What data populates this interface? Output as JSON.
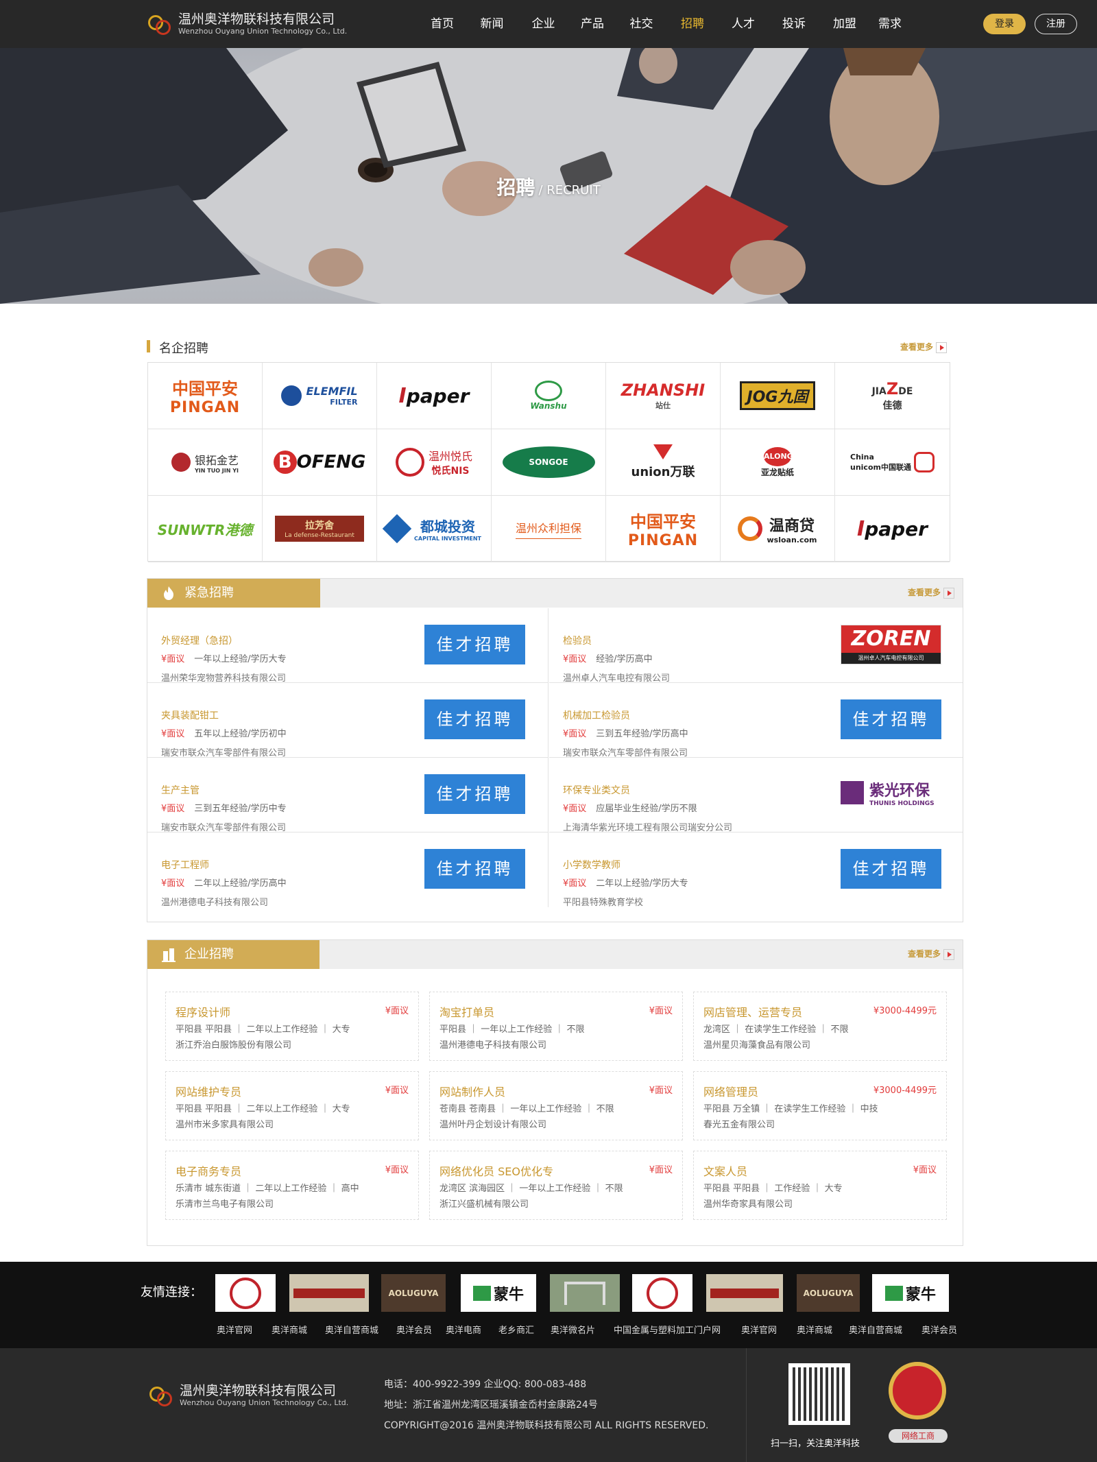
{
  "header": {
    "brand_zh": "温州奥洋物联科技有限公司",
    "brand_en": "Wenzhou Ouyang Union Technology Co., Ltd.",
    "nav": [
      "首页",
      "新闻",
      "企业",
      "产品",
      "社交",
      "招聘",
      "人才",
      "投诉",
      "加盟",
      "需求"
    ],
    "active_nav": "招聘",
    "login": "登录",
    "register": "注册"
  },
  "banner": {
    "title": "招聘",
    "subtitle": "/ RECRUIT"
  },
  "famous": {
    "title": "名企招聘",
    "more": "查看更多",
    "logos": [
      [
        "中国平安 PINGAN",
        "ELEMFIL FILTER",
        "paper",
        "Wanshu",
        "ZHANSHI 站仕",
        "JOG九固",
        "JIAZDE 佳德"
      ],
      [
        "银拓金艺",
        "BOFENG",
        "温州悦氏 悦氏NIS",
        "SONGOE",
        "union万联",
        "ALONG 亚龙贴纸",
        "China unicom中国联通"
      ],
      [
        "SUNWTR港德",
        "拉芳舍 La defense-Restaurant",
        "都城投资 CAPITAL INVESTMENT",
        "温州众利担保",
        "中国平安 PINGAN",
        "温商贷 wsloan.com",
        "paper"
      ]
    ]
  },
  "urgent": {
    "title": "紧急招聘",
    "more": "查看更多",
    "badge": "¥面议",
    "jiacai": "佳才招聘",
    "jobs": [
      {
        "title": "外贸经理（急招）",
        "req": "一年以上经验/学历大专",
        "company": "温州荣华宠物营养科技有限公司",
        "logo": "jiacai"
      },
      {
        "title": "检验员",
        "req": "经验/学历高中",
        "company": "温州卓人汽车电控有限公司",
        "logo": "ZOREN",
        "logo_sub": "温州卓人汽车电控有限公司"
      },
      {
        "title": "夹具装配钳工",
        "req": "五年以上经验/学历初中",
        "company": "瑞安市联众汽车零部件有限公司",
        "logo": "jiacai"
      },
      {
        "title": "机械加工检验员",
        "req": "三到五年经验/学历高中",
        "company": "瑞安市联众汽车零部件有限公司",
        "logo": "jiacai"
      },
      {
        "title": "生产主管",
        "req": "三到五年经验/学历中专",
        "company": "瑞安市联众汽车零部件有限公司",
        "logo": "jiacai"
      },
      {
        "title": "环保专业类文员",
        "req": "应届毕业生经验/学历不限",
        "company": "上海清华紫光环境工程有限公司瑞安分公司",
        "logo": "紫光环保",
        "logo_sub": "THUNIS HOLDINGS"
      },
      {
        "title": "电子工程师",
        "req": "二年以上经验/学历高中",
        "company": "温州港德电子科技有限公司",
        "logo": "jiacai"
      },
      {
        "title": "小学数学教师",
        "req": "二年以上经验/学历大专",
        "company": "平阳县特殊教育学校",
        "logo": "jiacai"
      }
    ]
  },
  "enterprise": {
    "title": "企业招聘",
    "more": "查看更多",
    "cards": [
      {
        "title": "程序设计师",
        "salary": "¥面议",
        "detail": "平阳县 平阳县 ｜ 二年以上工作经验 ｜ 大专",
        "company": "浙江乔治白服饰股份有限公司"
      },
      {
        "title": "淘宝打单员",
        "salary": "¥面议",
        "detail": "平阳县 ｜ 一年以上工作经验 ｜ 不限",
        "company": "温州港德电子科技有限公司"
      },
      {
        "title": "网店管理、运营专员",
        "salary": "¥3000-4499元",
        "detail": "龙湾区 ｜ 在读学生工作经验 ｜ 不限",
        "company": "温州星贝海藻食品有限公司"
      },
      {
        "title": "网站维护专员",
        "salary": "¥面议",
        "detail": "平阳县 平阳县 ｜ 二年以上工作经验 ｜ 大专",
        "company": "温州市米多家具有限公司"
      },
      {
        "title": "网站制作人员",
        "salary": "¥面议",
        "detail": "苍南县 苍南县 ｜ 一年以上工作经验 ｜ 不限",
        "company": "温州叶丹企划设计有限公司"
      },
      {
        "title": "网络管理员",
        "salary": "¥3000-4499元",
        "detail": "平阳县 万全镇 ｜ 在读学生工作经验 ｜ 中技",
        "company": "春光五金有限公司"
      },
      {
        "title": "电子商务专员",
        "salary": "¥面议",
        "detail": "乐清市 城东街道 ｜ 二年以上工作经验 ｜ 高中",
        "company": "乐清市兰鸟电子有限公司"
      },
      {
        "title": "网络优化员 SEO优化专",
        "salary": "¥面议",
        "detail": "龙湾区 滨海园区 ｜ 一年以上工作经验 ｜ 不限",
        "company": "浙江兴盛机械有限公司"
      },
      {
        "title": "文案人员",
        "salary": "¥面议",
        "detail": "平阳县 平阳县 ｜ 工作经验 ｜ 大专",
        "company": "温州华奇家具有限公司"
      }
    ]
  },
  "friend_links": {
    "label": "友情连接：",
    "images": [
      "seal",
      "banner",
      "AOLUGUYA",
      "蒙牛",
      "gate",
      "seal",
      "banner",
      "AOLUGUYA",
      "蒙牛"
    ],
    "names": [
      "奥洋官网",
      "奥洋商城",
      "奥洋自营商城",
      "奥洋会员",
      "奥洋电商",
      "老乡商汇",
      "奥洋微名片",
      "中国金属与塑料加工门户网",
      "奥洋官网",
      "奥洋商城",
      "奥洋自营商城",
      "奥洋会员"
    ]
  },
  "footer": {
    "brand_zh": "温州奥洋物联科技有限公司",
    "brand_en": "Wenzhou Ouyang Union Technology Co., Ltd.",
    "phone": "电话：400-9922-399    企业QQ: 800-083-488",
    "address": "地址：浙江省温州龙湾区瑶溪镇金岙村金康路24号",
    "copyright": "COPYRIGHT@2016 温州奥洋物联科技有限公司 ALL RIGHTS RESERVED.",
    "qr_caption": "扫一扫，关注奥洋科技",
    "badge_caption": "网络工商"
  },
  "colors": {
    "header_bg": "#282828",
    "accent_gold": "#d2ac55",
    "link_gold": "#c8972f",
    "red": "#e23b3b",
    "blue_btn": "#2e82d6"
  }
}
